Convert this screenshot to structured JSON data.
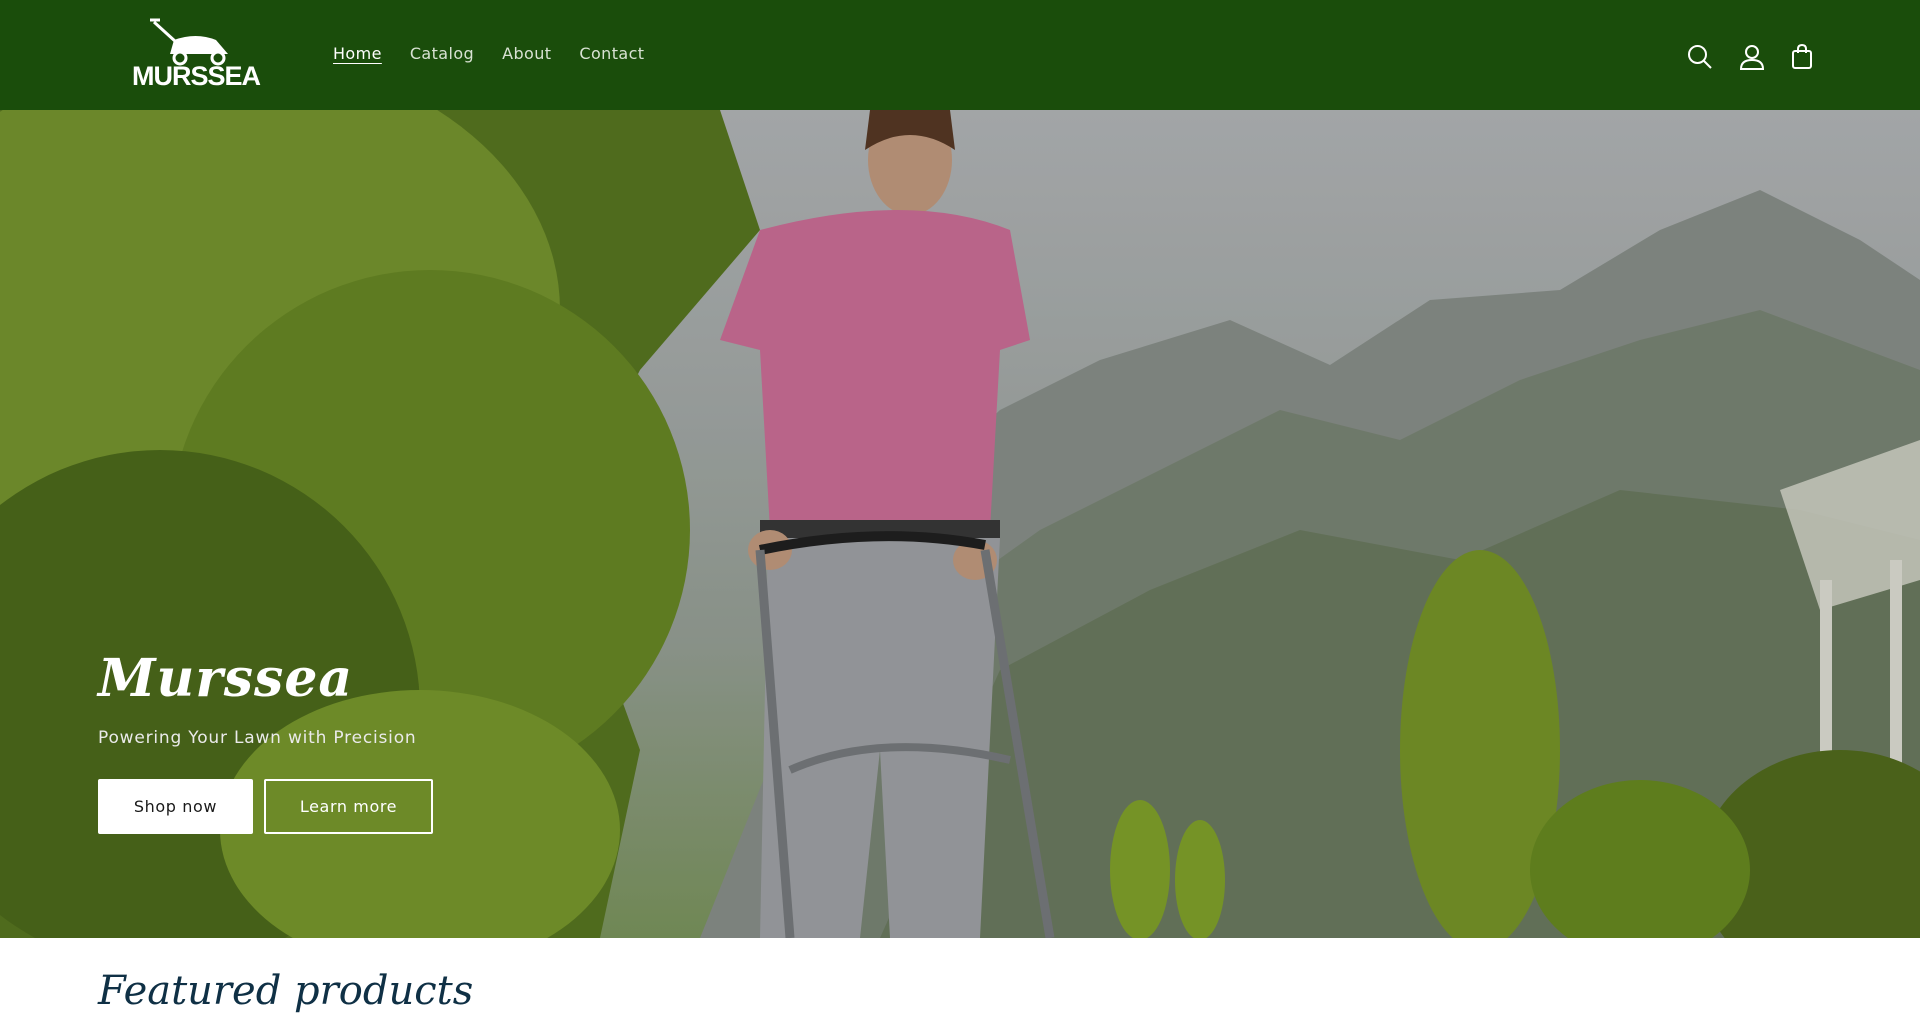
{
  "brand": {
    "logo_text": "MURSSEA"
  },
  "nav": {
    "items": [
      "Home",
      "Catalog",
      "About",
      "Contact"
    ],
    "active": "Home"
  },
  "header_icons": [
    "search-icon",
    "account-icon",
    "cart-icon"
  ],
  "hero": {
    "title": "Murssea",
    "subtitle": "Powering Your Lawn with Precision",
    "primary_button": "Shop now",
    "secondary_button": "Learn more"
  },
  "featured": {
    "title": "Featured products"
  },
  "colors": {
    "header_bg": "#1a4d0b",
    "hero_text": "#ffffff",
    "featured_title": "#0f3045"
  }
}
